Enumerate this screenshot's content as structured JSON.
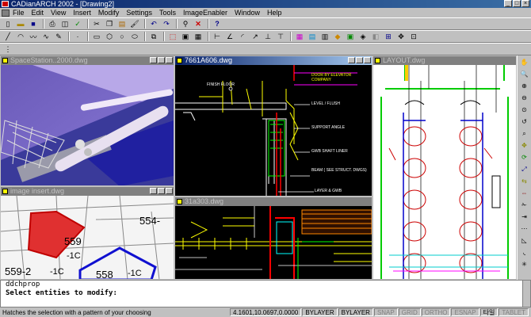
{
  "app": {
    "title": "CADianARCH 2002 - [Drawing2]"
  },
  "menu": [
    "File",
    "Edit",
    "View",
    "Insert",
    "Modify",
    "Settings",
    "Tools",
    "ImageEnabler",
    "Window",
    "Help"
  ],
  "windows": {
    "space": "SpaceStation..2000.dwg",
    "a606": "7661A606.dwg",
    "layout": "LAYOUT.dwg",
    "image": "image insert.dwg",
    "a303": "31a303.dwg"
  },
  "map_labels": [
    "554-",
    "559",
    "-1C",
    "559-2",
    "-1C",
    "558",
    "-1C"
  ],
  "detail_labels": [
    "FINISH FLOOR",
    "DOOR BY ELEVATOR COMPANY",
    "LEVEL / FLUSH",
    "SUPPORT ANGLE",
    "GWB SHAFT LINER",
    "BEAM ( SEE STRUCT. DWGS)",
    "LAYER & GWB"
  ],
  "command": {
    "history": "ddchprop",
    "prompt": "Select entities to modify:"
  },
  "status": {
    "message": "Hatches the selection with a pattern of your choosing",
    "coords": "4.1601,10.0697,0.0000",
    "layer1": "BYLAYER",
    "layer2": "BYLAYER",
    "snap": "SNAP",
    "grid": "GRID",
    "ortho": "ORTHO",
    "esnap": "ESNAP",
    "korean": "타일",
    "tablet": "TABLET"
  }
}
